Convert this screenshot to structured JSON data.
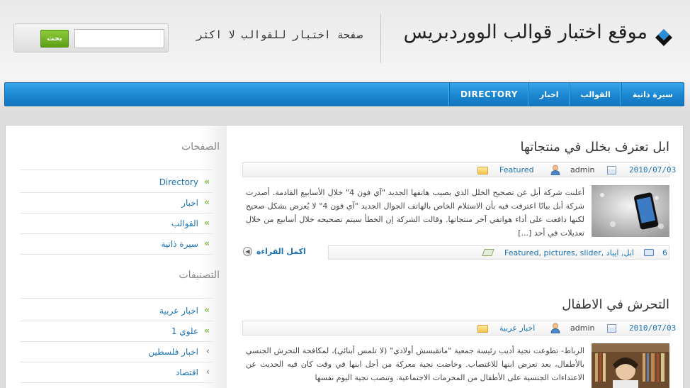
{
  "header": {
    "site_title": "موقع اختبار قوالب الووردبريس",
    "tagline": "صفحة اختبار للقوالب لا اكثر",
    "search": {
      "placeholder": "",
      "button_label": "بحث"
    }
  },
  "nav": {
    "items": [
      {
        "label": "سيرة ذاتية"
      },
      {
        "label": "القوالب"
      },
      {
        "label": "اخبار"
      },
      {
        "label": "DIRECTORY"
      }
    ]
  },
  "sidebar": {
    "pages_title": "الصفحات",
    "pages": [
      {
        "label": "Directory"
      },
      {
        "label": "اخبار"
      },
      {
        "label": "القوالب"
      },
      {
        "label": "سيرة ذاتية"
      }
    ],
    "categories_title": "التصنيفات",
    "categories": [
      {
        "label": "اخبار عربية"
      },
      {
        "label": "علوي 1"
      },
      {
        "label": "اخبار فلسطين"
      },
      {
        "label": "اقتصاد"
      }
    ]
  },
  "posts": [
    {
      "title": "ابل تعترف بخلل في منتجاتها",
      "date": "2010/07/03",
      "author": "admin",
      "category": "Featured",
      "excerpt": "أعلنت شركة أبل عن تصحيح الخلل الذي يصيب هاتفها الجديد \"آي فون 4\" خلال الأسابيع القادمة. أصدرت شركة أبل بيانًا اعترفت فيه بأن الاستلام الخاص بالهاتف الجوال الجديد \"آي فون 4\" لا يُعرض بشكل صحيح لكنها دافعت على أداء هواتفي آخر منتجاتها. وقالت الشركة إن الخطأ سيتم تصحيحه خلال أسابيع من خلال تعديلات في أحد [...]",
      "comments": "6",
      "tags": "Featured, pictures, slider, ابل, ايباد",
      "read_more": "اكمل القراءة"
    },
    {
      "title": "التحرش في الاطفال",
      "date": "2010/07/03",
      "author": "admin",
      "category": "اخبار عربية",
      "excerpt": "الرباط- تطوعت نجية أديب رئيسة جمعية \"ماتقيسش أولادي\" (لا تلمس أبنائي)، لمكافحة التحرش الجنسي بالأطفال، بعد تعرض ابنها للاغتصاب. وخاضت نجية معركة من أجل ابنها في وقت كان فيه الحديث عن الاعتداءات الجنسية على الأطفال من المحرمات الاجتماعية. وتنصب نجية اليوم نفسها"
    }
  ],
  "colors": {
    "nav_blue": "#1b86d1",
    "link_blue": "#1b73b5",
    "chevron_green": "#7fb83a",
    "search_button_green": "#6fb022"
  }
}
